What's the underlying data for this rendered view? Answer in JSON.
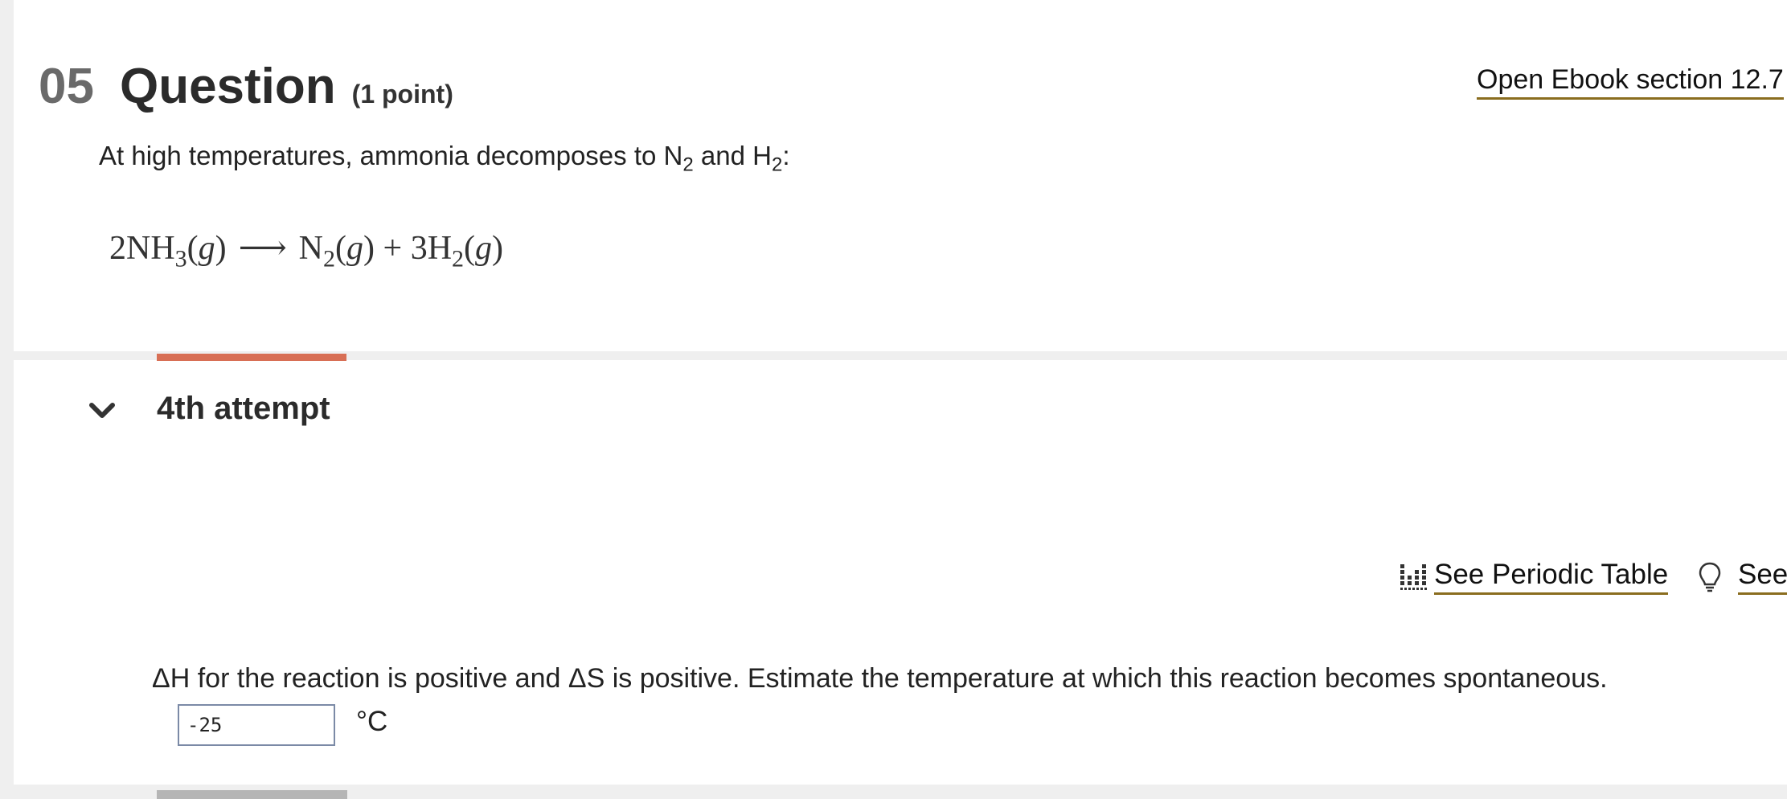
{
  "question": {
    "number": "05",
    "title": "Question",
    "points": "(1 point)",
    "ebook_link": "Open Ebook section  12.7",
    "intro": {
      "text_before": "At high temperatures, ammonia decomposes to N",
      "sub1": "2",
      "mid": " and H",
      "sub2": "2",
      "after": ":"
    },
    "equation": {
      "coef1": "2NH",
      "sub_nh3": "3",
      "phase": "g",
      "arrow": "⟶",
      "n": "N",
      "sub_n2": "2",
      "plus": "+",
      "coef_h": "3H",
      "sub_h2": "2"
    }
  },
  "attempt": {
    "label": "4th attempt",
    "tools": {
      "periodic_table": "See Periodic Table",
      "hint": "See Hint"
    },
    "prompt": "ΔH for the reaction is positive and ΔS is positive. Estimate the temperature at which this reaction becomes spontaneous.",
    "answer_value": "-25",
    "unit": "°C"
  },
  "colors": {
    "accent_orange": "#d86f55",
    "link_underline": "#8a6d1f",
    "input_border": "#7b8aa6"
  }
}
